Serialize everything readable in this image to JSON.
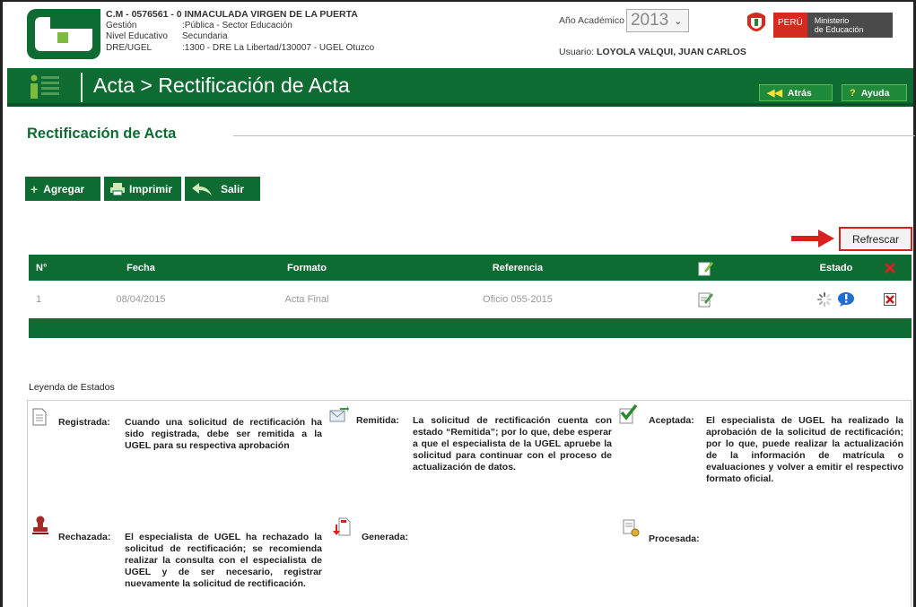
{
  "header": {
    "cm_line": "C.M - 0576561 - 0  INMACULADA VIRGEN DE LA PUERTA",
    "rows": [
      {
        "key": "Gestión",
        "value": ":Pública - Sector Educación"
      },
      {
        "key": "Nivel Educativo",
        "value": "Secundaria"
      },
      {
        "key": "DRE/UGEL",
        "value": ":1300 - DRE La Libertad/130007 - UGEL Otuzco"
      }
    ],
    "year_label": "Año Académico",
    "year_value": "2013",
    "user_label": "Usuario:",
    "user_value": "LOYOLA VALQUI, JUAN CARLOS",
    "peru_label": "PERÚ",
    "ministry_label_1": "Ministerio",
    "ministry_label_2": "de Educación"
  },
  "title_bar": {
    "title": "Acta > Rectificación de Acta",
    "back_label": "Atrás",
    "help_label": "Ayuda"
  },
  "section": {
    "title": "Rectificación de Acta"
  },
  "toolbar": {
    "add_label": "Agregar",
    "print_label": "Imprimir",
    "exit_label": "Salir",
    "refresh_label": "Refrescar"
  },
  "table": {
    "headers": {
      "n": "N°",
      "fecha": "Fecha",
      "formato": "Formato",
      "referencia": "Referencia",
      "estado": "Estado"
    },
    "rows": [
      {
        "n": "1",
        "fecha": "08/04/2015",
        "formato": "Acta Final",
        "referencia": "Oficio 055-2015"
      }
    ]
  },
  "legend": {
    "title": "Leyenda de Estados",
    "items": [
      {
        "name": "Registrada:",
        "desc": "Cuando una solicitud de rectificación ha sido registrada, debe ser remitida a la UGEL para su respectiva aprobación"
      },
      {
        "name": "Remitida:",
        "desc": "La solicitud de rectificación cuenta con estado “Remitida”; por lo que, debe esperar a que el especialista de la UGEL apruebe la solicitud para continuar con el proceso de actualización de datos."
      },
      {
        "name": "Aceptada:",
        "desc": "El especialista de UGEL ha realizado la aprobación de la solicitud de rectificación; por lo que, puede realizar la actualización de la información de matrícula o evaluaciones y volver a emitir el respectivo formato oficial."
      },
      {
        "name": "Rechazada:",
        "desc": "El especialista de UGEL ha rechazado la solicitud de rectificación; se recomienda realizar la consulta con el especialista de UGEL y de ser necesario, registrar nuevamente la solicitud de rectificación."
      },
      {
        "name": "Generada:",
        "desc": ""
      },
      {
        "name": "Procesada:",
        "desc": ""
      }
    ]
  },
  "colors": {
    "brand_green": "#0e6b32",
    "highlight_red": "#d92020"
  }
}
